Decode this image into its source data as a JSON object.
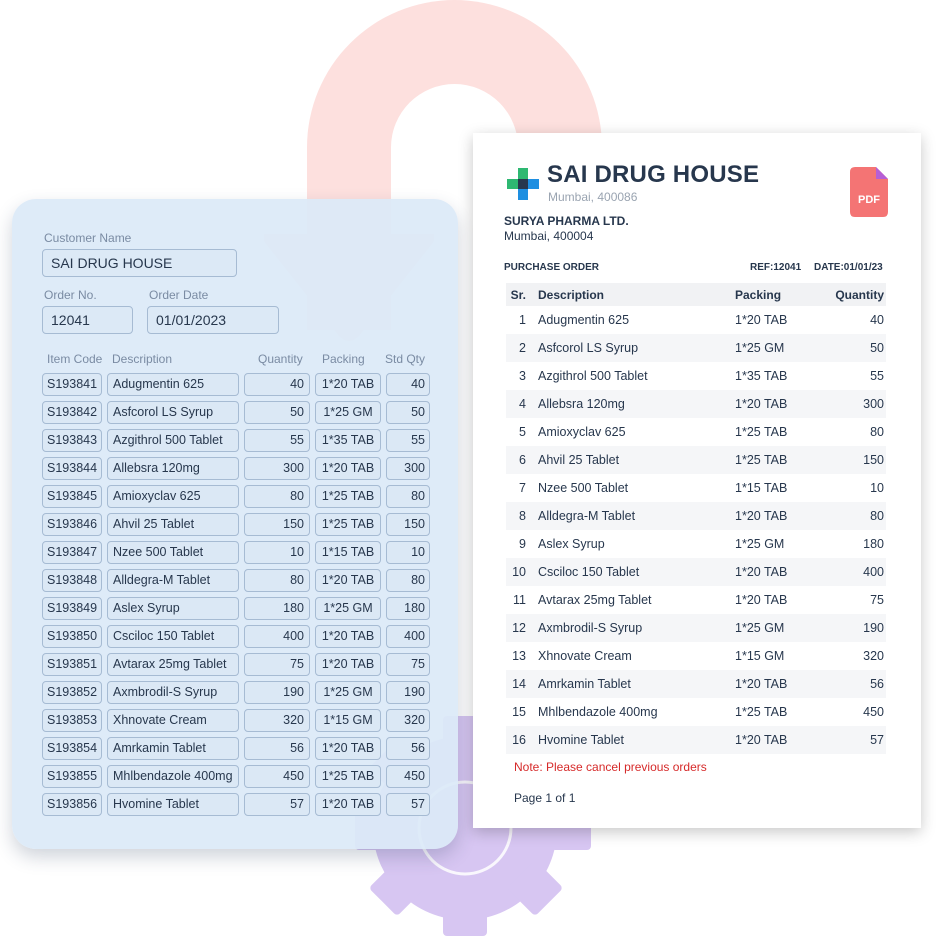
{
  "colors": {
    "form_bg": "#dcebf7",
    "arrow": "#fde0de",
    "gear": "#d6c5f1",
    "pdf_icon": "#f47474",
    "note_red": "#d62a2a"
  },
  "form": {
    "customer_label": "Customer Name",
    "customer_value": "SAI DRUG HOUSE",
    "order_no_label": "Order No.",
    "order_no_value": "12041",
    "order_date_label": "Order Date",
    "order_date_value": "01/01/2023",
    "headers": {
      "code": "Item Code",
      "desc": "Description",
      "qty": "Quantity",
      "pack": "Packing",
      "std": "Std Qty"
    },
    "items": [
      {
        "code": "S193841",
        "desc": "Adugmentin 625",
        "qty": "40",
        "pack": "1*20 TAB",
        "std": "40"
      },
      {
        "code": "S193842",
        "desc": "Asfcorol LS Syrup",
        "qty": "50",
        "pack": "1*25 GM",
        "std": "50"
      },
      {
        "code": "S193843",
        "desc": "Azgithrol 500 Tablet",
        "qty": "55",
        "pack": "1*35 TAB",
        "std": "55"
      },
      {
        "code": "S193844",
        "desc": "Allebsra 120mg",
        "qty": "300",
        "pack": "1*20 TAB",
        "std": "300"
      },
      {
        "code": "S193845",
        "desc": "Amioxyclav 625",
        "qty": "80",
        "pack": "1*25 TAB",
        "std": "80"
      },
      {
        "code": "S193846",
        "desc": "Ahvil 25 Tablet",
        "qty": "150",
        "pack": "1*25 TAB",
        "std": "150"
      },
      {
        "code": "S193847",
        "desc": "Nzee 500 Tablet",
        "qty": "10",
        "pack": "1*15 TAB",
        "std": "10"
      },
      {
        "code": "S193848",
        "desc": "Alldegra-M Tablet",
        "qty": "80",
        "pack": "1*20 TAB",
        "std": "80"
      },
      {
        "code": "S193849",
        "desc": "Aslex Syrup",
        "qty": "180",
        "pack": "1*25 GM",
        "std": "180"
      },
      {
        "code": "S193850",
        "desc": "Csciloc 150 Tablet",
        "qty": "400",
        "pack": "1*20 TAB",
        "std": "400"
      },
      {
        "code": "S193851",
        "desc": "Avtarax 25mg Tablet",
        "qty": "75",
        "pack": "1*20 TAB",
        "std": "75"
      },
      {
        "code": "S193852",
        "desc": "Axmbrodil-S Syrup",
        "qty": "190",
        "pack": "1*25 GM",
        "std": "190"
      },
      {
        "code": "S193853",
        "desc": "Xhnovate Cream",
        "qty": "320",
        "pack": "1*15 GM",
        "std": "320"
      },
      {
        "code": "S193854",
        "desc": "Amrkamin Tablet",
        "qty": "56",
        "pack": "1*20 TAB",
        "std": "56"
      },
      {
        "code": "S193855",
        "desc": "Mhlbendazole 400mg",
        "qty": "450",
        "pack": "1*25 TAB",
        "std": "450"
      },
      {
        "code": "S193856",
        "desc": "Hvomine Tablet",
        "qty": "57",
        "pack": "1*20 TAB",
        "std": "57"
      }
    ]
  },
  "doc": {
    "title": "SAI DRUG HOUSE",
    "city": "Mumbai, 400086",
    "pdf_label": "PDF",
    "supplier": "SURYA PHARMA LTD.",
    "supplier_city": "Mumbai, 400004",
    "po_label": "PURCHASE ORDER",
    "ref": "REF:12041",
    "date": "DATE:01/01/23",
    "headers": {
      "sr": "Sr.",
      "desc": "Description",
      "pack": "Packing",
      "qty": "Quantity"
    },
    "rows": [
      {
        "sr": "1",
        "desc": "Adugmentin 625",
        "pack": "1*20 TAB",
        "qty": "40"
      },
      {
        "sr": "2",
        "desc": "Asfcorol LS Syrup",
        "pack": "1*25 GM",
        "qty": "50"
      },
      {
        "sr": "3",
        "desc": "Azgithrol 500 Tablet",
        "pack": "1*35 TAB",
        "qty": "55"
      },
      {
        "sr": "4",
        "desc": "Allebsra 120mg",
        "pack": "1*20 TAB",
        "qty": "300"
      },
      {
        "sr": "5",
        "desc": "Amioxyclav 625",
        "pack": "1*25 TAB",
        "qty": "80"
      },
      {
        "sr": "6",
        "desc": "Ahvil 25 Tablet",
        "pack": "1*25 TAB",
        "qty": "150"
      },
      {
        "sr": "7",
        "desc": "Nzee 500 Tablet",
        "pack": "1*15 TAB",
        "qty": "10"
      },
      {
        "sr": "8",
        "desc": "Alldegra-M Tablet",
        "pack": "1*20 TAB",
        "qty": "80"
      },
      {
        "sr": "9",
        "desc": "Aslex Syrup",
        "pack": "1*25 GM",
        "qty": "180"
      },
      {
        "sr": "10",
        "desc": "Csciloc 150 Tablet",
        "pack": "1*20 TAB",
        "qty": "400"
      },
      {
        "sr": "11",
        "desc": "Avtarax 25mg Tablet",
        "pack": "1*20 TAB",
        "qty": "75"
      },
      {
        "sr": "12",
        "desc": "Axmbrodil-S Syrup",
        "pack": "1*25 GM",
        "qty": "190"
      },
      {
        "sr": "13",
        "desc": "Xhnovate Cream",
        "pack": "1*15 GM",
        "qty": "320"
      },
      {
        "sr": "14",
        "desc": "Amrkamin Tablet",
        "pack": "1*20 TAB",
        "qty": "56"
      },
      {
        "sr": "15",
        "desc": "Mhlbendazole 400mg",
        "pack": "1*25 TAB",
        "qty": "450"
      },
      {
        "sr": "16",
        "desc": "Hvomine Tablet",
        "pack": "1*20 TAB",
        "qty": "57"
      }
    ],
    "note": "Note: Please cancel previous orders",
    "page": "Page 1 of 1"
  }
}
